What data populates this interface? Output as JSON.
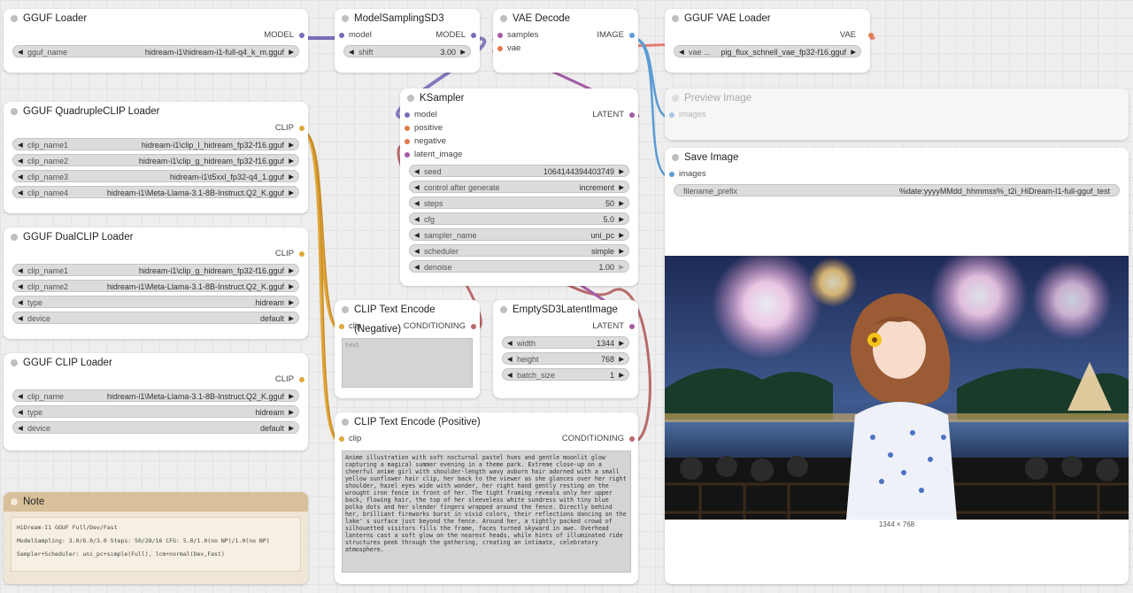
{
  "colors": {
    "model": "#7b6bb8",
    "clip": "#e0a73a",
    "vae": "#e05a4a",
    "conditioning": "#b86b6b",
    "latent": "#a45ba4",
    "image": "#5b9bd5"
  },
  "gguf_loader": {
    "title": "GGUF Loader",
    "out": "MODEL",
    "widget": {
      "name": "gguf_name",
      "value": "hidream-i1\\hidream-i1-full-q4_k_m.gguf"
    }
  },
  "model_sampling": {
    "title": "ModelSamplingSD3",
    "in": "model",
    "out": "MODEL",
    "widget": {
      "name": "shift",
      "value": "3.00"
    }
  },
  "vae_decode": {
    "title": "VAE Decode",
    "inputs": [
      "samples",
      "vae"
    ],
    "out": "IMAGE"
  },
  "gguf_vae_loader": {
    "title": "GGUF VAE Loader",
    "out": "VAE",
    "widget": {
      "name": "vae ...",
      "value": "pig_flux_schnell_vae_fp32-f16.gguf"
    }
  },
  "quad_clip": {
    "title": "GGUF QuadrupleCLIP Loader",
    "out": "CLIP",
    "widgets": [
      {
        "name": "clip_name1",
        "value": "hidream-i1\\clip_l_hidream_fp32-f16.gguf"
      },
      {
        "name": "clip_name2",
        "value": "hidream-i1\\clip_g_hidream_fp32-f16.gguf"
      },
      {
        "name": "clip_name3",
        "value": "hidream-i1\\t5xxl_fp32-q4_1.gguf"
      },
      {
        "name": "clip_name4",
        "value": "hidream-i1\\Meta-Llama-3.1-8B-Instruct.Q2_K.gguf"
      }
    ]
  },
  "dual_clip": {
    "title": "GGUF DualCLIP Loader",
    "out": "CLIP",
    "widgets": [
      {
        "name": "clip_name1",
        "value": "hidream-i1\\clip_g_hidream_fp32-f16.gguf"
      },
      {
        "name": "clip_name2",
        "value": "hidream-i1\\Meta-Llama-3.1-8B-Instruct.Q2_K.gguf"
      },
      {
        "name": "type",
        "value": "hidream"
      },
      {
        "name": "device",
        "value": "default"
      }
    ]
  },
  "clip_loader": {
    "title": "GGUF CLIP Loader",
    "out": "CLIP",
    "widgets": [
      {
        "name": "clip_name",
        "value": "hidream-i1\\Meta-Llama-3.1-8B-Instruct.Q2_K.gguf"
      },
      {
        "name": "type",
        "value": "hidream"
      },
      {
        "name": "device",
        "value": "default"
      }
    ]
  },
  "note": {
    "title": "Note",
    "lines": [
      "HiDream-I1 GGUF Full/Dev/Fast",
      "ModelSampling: 3.0/6.0/3.0  Steps: 50/28/16  CFG: 5.0/1.0(no NP)/1.0(no NP)",
      "Sampler+Scheduler: uni_pc+simple(Full), lcm+normal(Dev,Fast)"
    ]
  },
  "ksampler": {
    "title": "KSampler",
    "inputs": [
      "model",
      "positive",
      "negative",
      "latent_image"
    ],
    "out": "LATENT",
    "widgets": [
      {
        "name": "seed",
        "value": "1064144394403749"
      },
      {
        "name": "control after generate",
        "value": "increment"
      },
      {
        "name": "steps",
        "value": "50"
      },
      {
        "name": "cfg",
        "value": "5.0"
      },
      {
        "name": "sampler_name",
        "value": "uni_pc"
      },
      {
        "name": "scheduler",
        "value": "simple"
      },
      {
        "name": "denoise",
        "value": "1.00"
      }
    ]
  },
  "clip_negative": {
    "title": "CLIP Text Encode (Negative)",
    "in": "clip",
    "out": "CONDITIONING",
    "placeholder": "text"
  },
  "empty_latent": {
    "title": "EmptySD3LatentImage",
    "out": "LATENT",
    "widgets": [
      {
        "name": "width",
        "value": "1344"
      },
      {
        "name": "height",
        "value": "768"
      },
      {
        "name": "batch_size",
        "value": "1"
      }
    ]
  },
  "clip_positive": {
    "title": "CLIP Text Encode (Positive)",
    "in": "clip",
    "out": "CONDITIONING",
    "text": "Anime illustration with soft nocturnal pastel hues and gentle moonlit glow capturing a magical summer evening in a theme park. Extreme close-up on a cheerful anime girl with shoulder-length wavy auburn hair adorned with a small yellow sunflower hair clip, her back to the viewer as she glances over her right shoulder, hazel eyes wide with wonder, her right hand gently resting on the wrought iron fence in front of her. The tight framing reveals only her upper back, flowing hair, the top of her sleeveless white sundress with tiny blue polka dots and her slender fingers wrapped around the fence. Directly behind her, brilliant fireworks burst in vivid colors, their reflections dancing on the lake' s surface just beyond the fence. Around her, a tightly packed crowd of silhouetted visitors fills the frame, faces turned skyward in awe. Overhead lanterns cast a soft glow on the nearest heads, while hints of illuminated ride structures peek through the gathering, creating an intimate, celebratory atmosphere."
  },
  "preview_image": {
    "title": "Preview Image",
    "in": "images"
  },
  "save_image": {
    "title": "Save Image",
    "in": "images",
    "widget": {
      "name": "filename_prefix",
      "value": "%date:yyyyMMdd_hhmmss%_t2i_HiDream-I1-full-gguf_test"
    },
    "image_size": "1344 × 768"
  }
}
